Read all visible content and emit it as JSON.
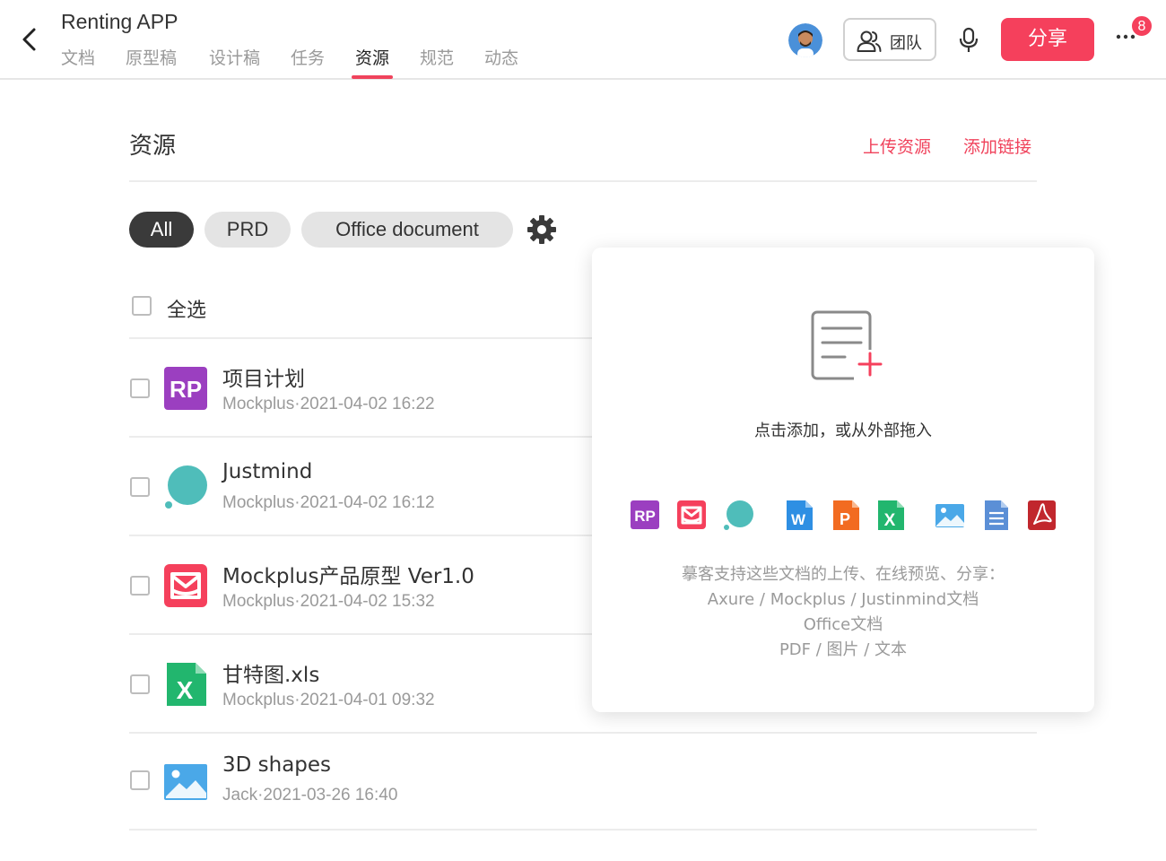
{
  "app": {
    "title": "Renting APP"
  },
  "tabs": [
    {
      "label": "文档"
    },
    {
      "label": "原型稿"
    },
    {
      "label": "设计稿"
    },
    {
      "label": "任务"
    },
    {
      "label": "资源",
      "active": true
    },
    {
      "label": "规范"
    },
    {
      "label": "动态"
    }
  ],
  "toolbar": {
    "team_label": "团队",
    "share_label": "分享",
    "notifications": "8"
  },
  "section": {
    "title": "资源",
    "upload_label": "上传资源",
    "add_link_label": "添加链接"
  },
  "filters": [
    {
      "label": "All"
    },
    {
      "label": "PRD"
    },
    {
      "label": "Office document"
    }
  ],
  "select_all_label": "全选",
  "files": [
    {
      "name": "项目计划",
      "meta": "Mockplus·2021-04-02 16:22",
      "icon": "axure-rp-icon"
    },
    {
      "name": "Justmind",
      "meta": "Mockplus·2021-04-02 16:12",
      "icon": "justinmind-icon"
    },
    {
      "name": "Mockplus产品原型 Ver1.0",
      "meta": "Mockplus·2021-04-02 15:32",
      "icon": "mockplus-icon"
    },
    {
      "name": "甘特图.xls",
      "meta": "Mockplus·2021-04-01 09:32",
      "icon": "excel-icon"
    },
    {
      "name": "3D shapes",
      "meta": "Jack·2021-03-26 16:40",
      "icon": "image-icon"
    }
  ],
  "popup": {
    "hint": "点击添加，或从外部拖入",
    "desc_line1": "摹客支持这些文档的上传、在线预览、分享：",
    "desc_line2": "Axure / Mockplus / Justinmind文档",
    "desc_line3": "Office文档",
    "desc_line4": "PDF / 图片 / 文本"
  },
  "colors": {
    "accent": "#f5405c",
    "rp": "#9b3fc0",
    "mockplus": "#f5405c",
    "justinmind": "#4fbdba",
    "word": "#2e8fe3",
    "ppt": "#f26b21",
    "excel": "#22b66e",
    "image": "#4aa8e8",
    "text": "#5b8fd6",
    "pdf": "#c1272d"
  }
}
